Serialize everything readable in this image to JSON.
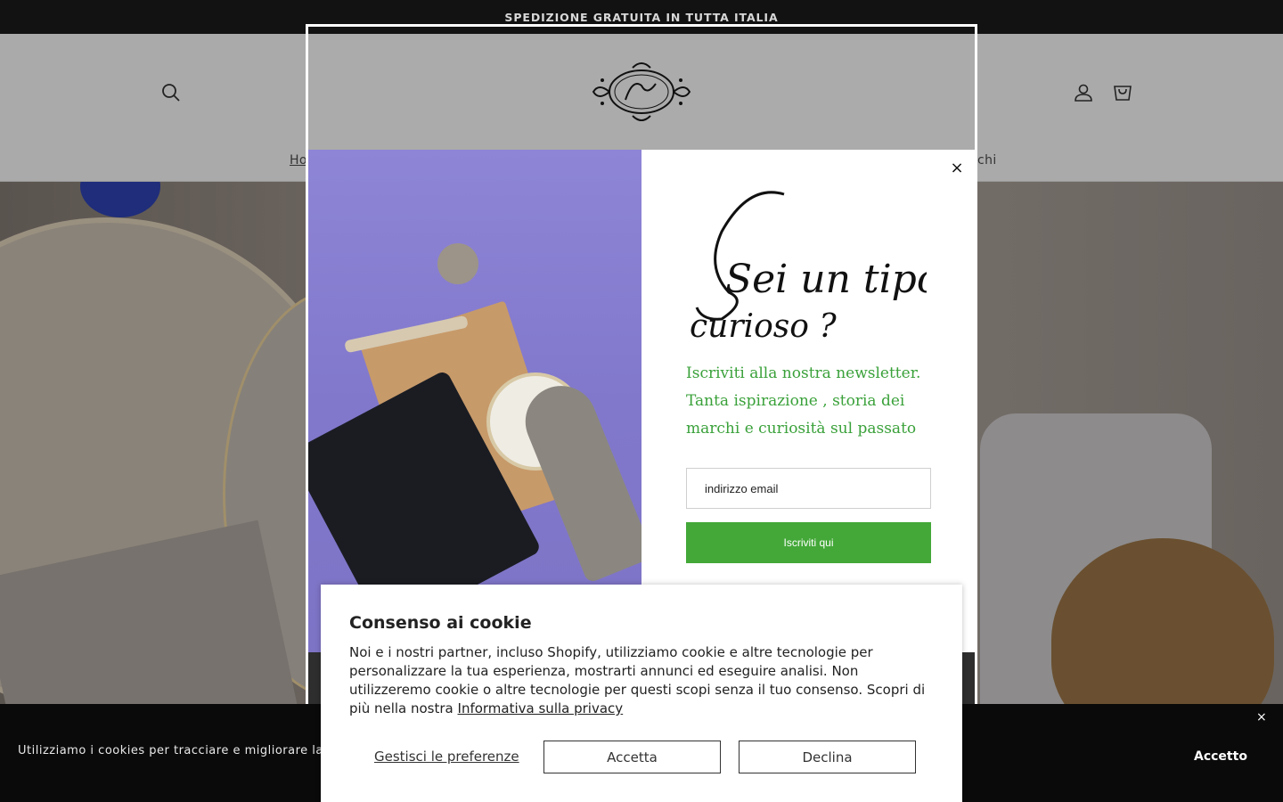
{
  "announcement": "SPEDIZIONE GRATUITA IN TUTTA ITALIA",
  "header": {
    "nav_items": [
      "Ho",
      "chi"
    ]
  },
  "newsletter": {
    "script_title_line1": "Sei un tipo",
    "script_title_line2": "curioso ?",
    "text": "Iscriviti alla nostra newsletter. Tanta ispirazione , storia dei marchi e curiosità sul passato",
    "email_placeholder": "indirizzo email",
    "subscribe_label": "Iscriviti qui",
    "close_label": "×"
  },
  "cookie_bar": {
    "text": "Utilizziamo i cookies per tracciare e migliorare la tua esperienza",
    "close_label": "×",
    "accept_label": "Accetto"
  },
  "consent": {
    "title": "Consenso ai cookie",
    "body": "Noi e i nostri partner, incluso Shopify, utilizziamo cookie e altre tecnologie per personalizzare la tua esperienza, mostrarti annunci ed eseguire analisi. Non utilizzeremo cookie o altre tecnologie per questi scopi senza il tuo consenso. Scopri di più nella nostra",
    "privacy_link": "Informativa sulla privacy",
    "manage_label": "Gestisci le preferenze",
    "accept_label": "Accetta",
    "decline_label": "Declina"
  },
  "colors": {
    "accent_green": "#43a838",
    "text_green": "#3aa13a",
    "announcement_bg": "#121212"
  },
  "icons": [
    "search-icon",
    "account-icon",
    "cart-icon",
    "close-icon"
  ]
}
